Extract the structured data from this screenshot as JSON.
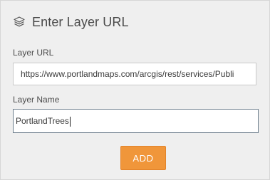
{
  "header": {
    "icon": "layers-icon",
    "title": "Enter Layer URL"
  },
  "form": {
    "url_label": "Layer URL",
    "url_value": "https://www.portlandmaps.com/arcgis/rest/services/Publi",
    "name_label": "Layer Name",
    "name_value": "PortlandTrees"
  },
  "actions": {
    "add_label": "ADD"
  },
  "colors": {
    "panel_background": "#efefef",
    "accent": "#f0963a",
    "focus_border": "#6c7d8c"
  }
}
